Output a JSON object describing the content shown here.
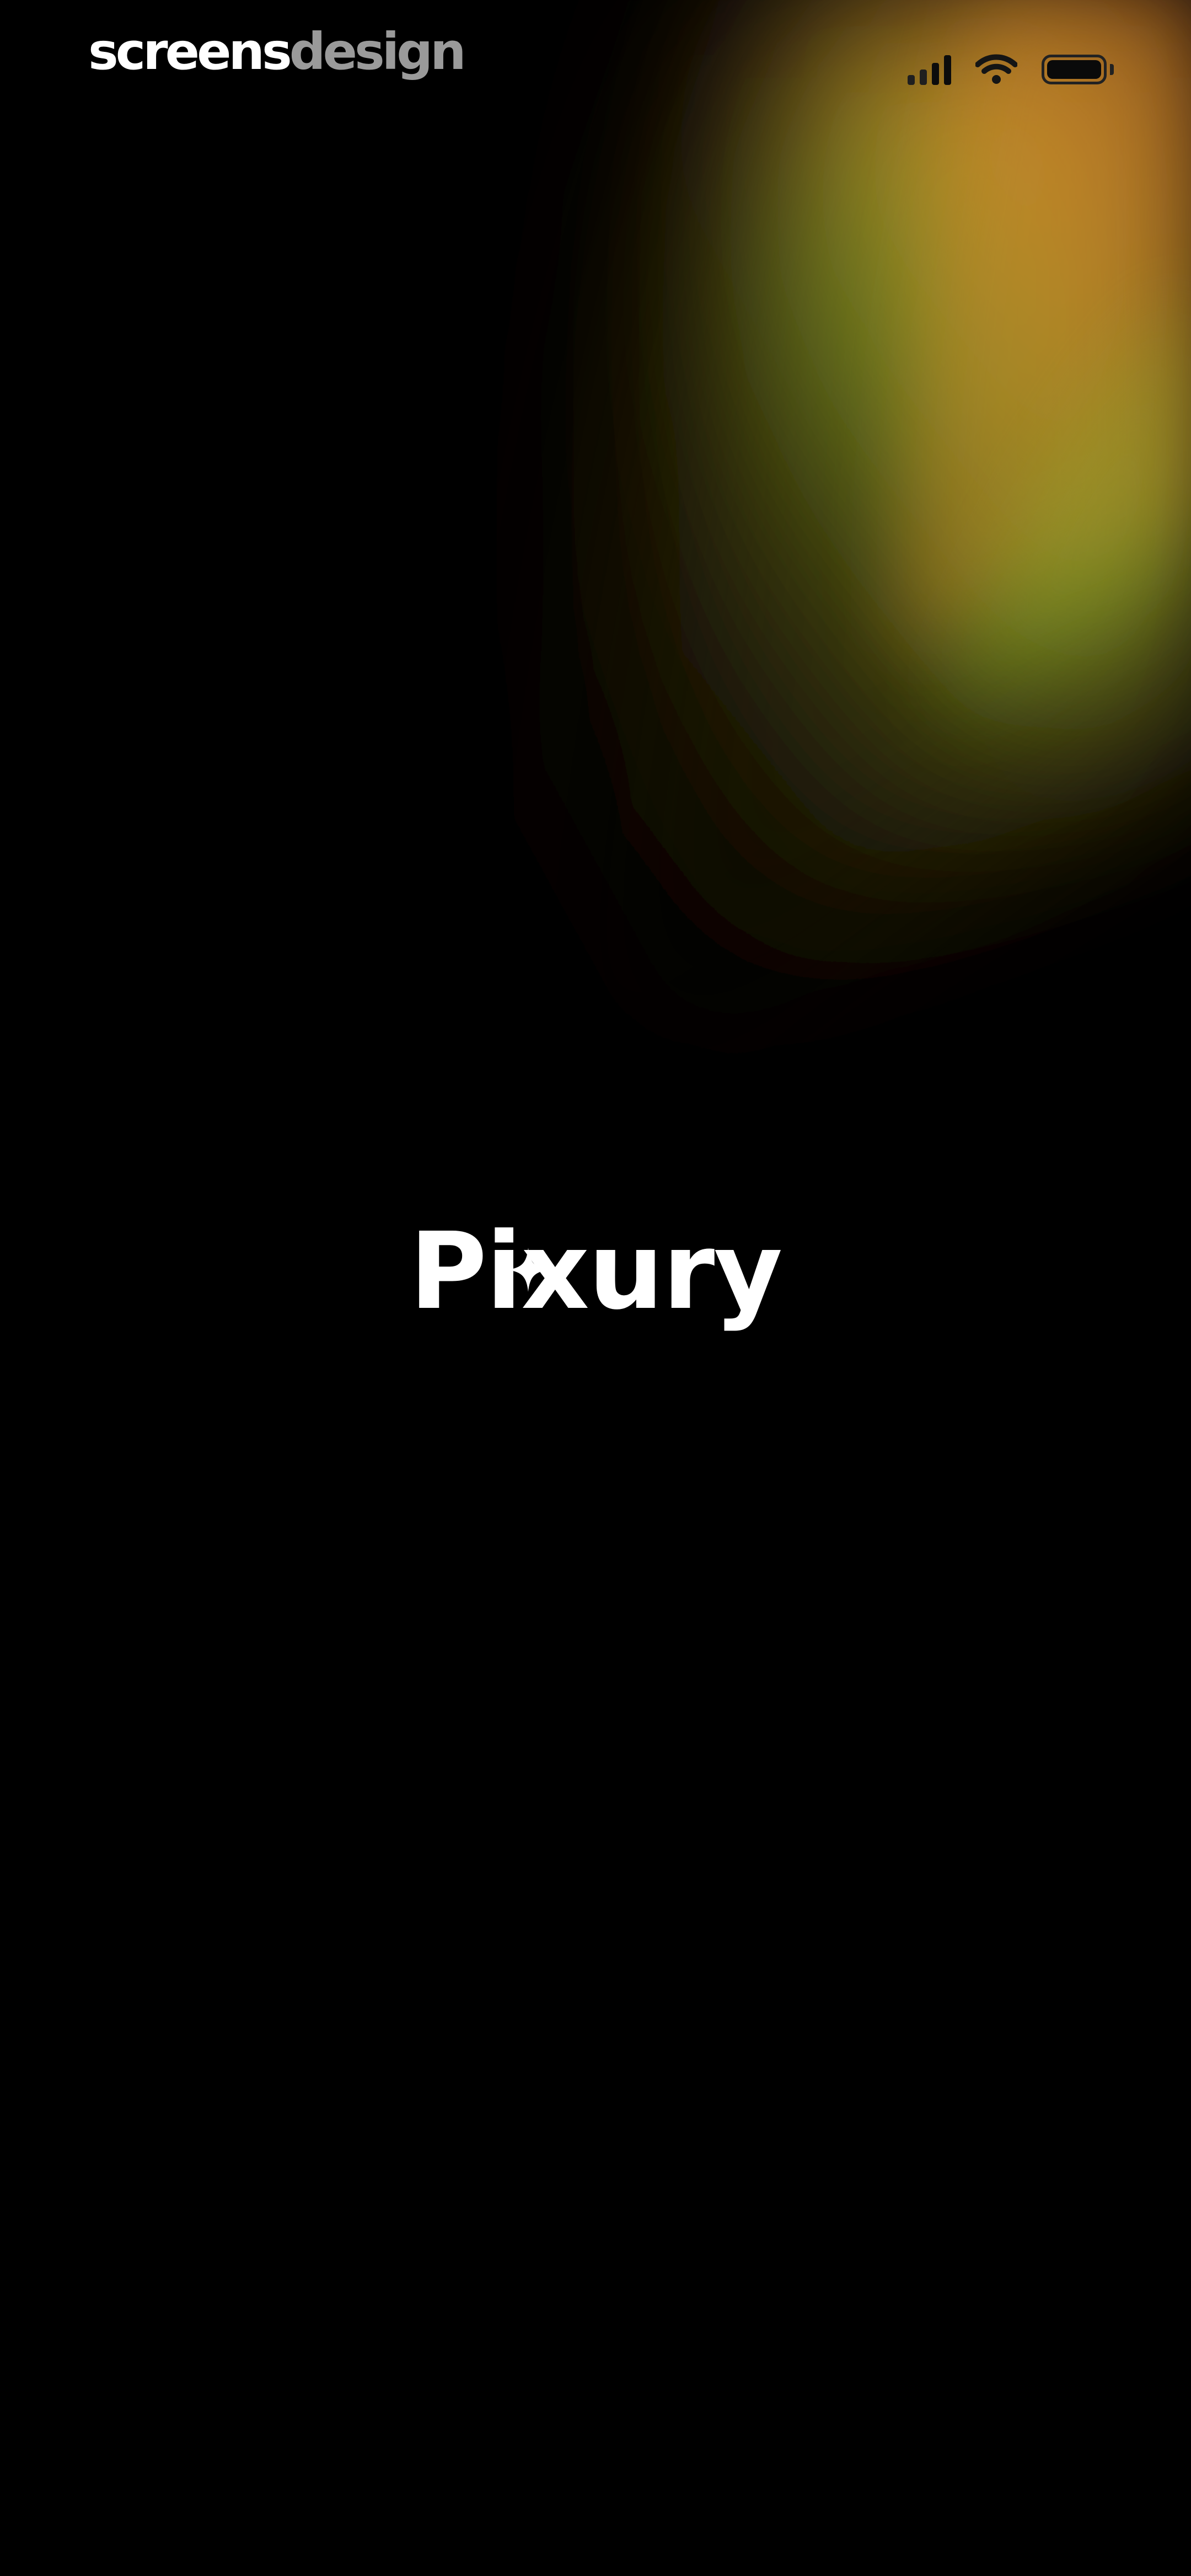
{
  "watermark": {
    "part1": "screens",
    "part2": "design"
  },
  "status_bar": {
    "icons": [
      "signal-icon",
      "wifi-icon",
      "battery-icon"
    ]
  },
  "splash": {
    "logo_text": "Pixury",
    "logo_icon": "sparkle-icon"
  },
  "colors": {
    "background": "#000000",
    "logo": "#ffffff",
    "glow_orange": "#c96a28",
    "glow_yellow": "#c89a2c",
    "glow_green": "#7f9a2a"
  }
}
